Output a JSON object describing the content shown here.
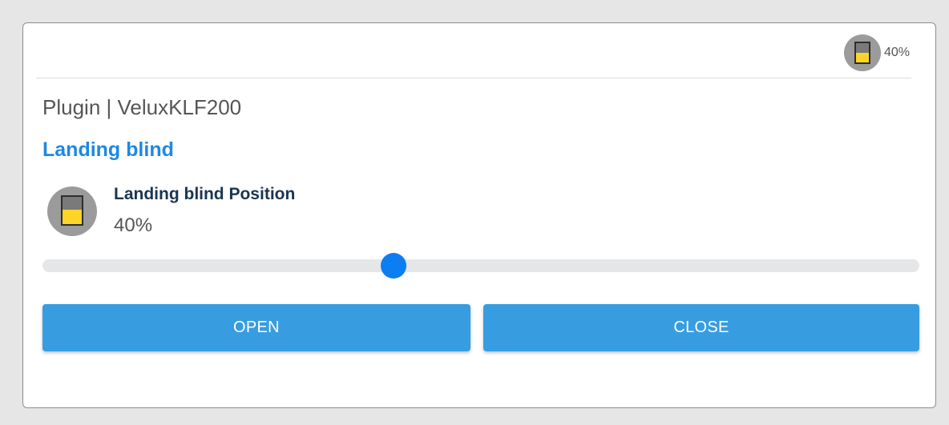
{
  "header": {
    "status_icon": "blind-icon",
    "status_value": "40%"
  },
  "plugin_line": "Plugin | VeluxKLF200",
  "device": {
    "title": "Landing blind"
  },
  "item": {
    "icon": "blind-icon",
    "label": "Landing blind Position",
    "value": "40%",
    "position_fraction": 0.4
  },
  "buttons": {
    "open_label": "OPEN",
    "close_label": "CLOSE"
  },
  "colors": {
    "accent": "#1e88e5",
    "button": "#379de0",
    "slider_thumb": "#0d7df2",
    "blind_fill": "#ffd429"
  }
}
